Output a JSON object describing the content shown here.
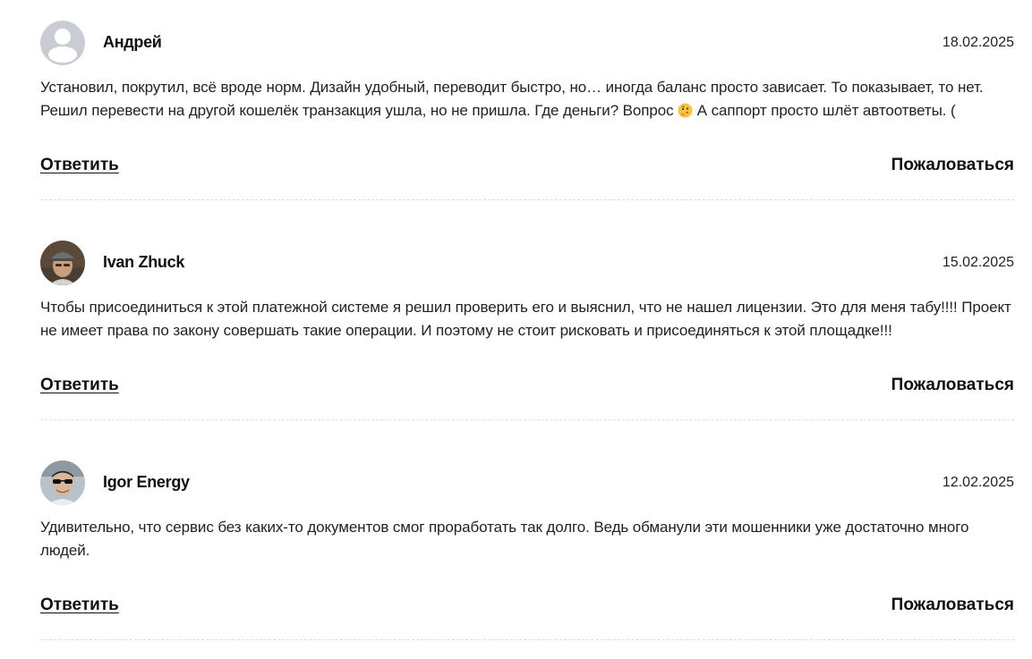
{
  "comments": [
    {
      "author": "Андрей",
      "date": "18.02.2025",
      "avatar": "default-user-icon",
      "text_before_emoji": "Установил, покрутил, всё вроде норм. Дизайн удобный, переводит быстро, но… иногда баланс просто зависает. То показывает, то нет. Решил перевести на другой кошелёк транзакция ушла, но не пришла. Где деньги? Вопрос ",
      "emoji": "thinking-face-emoji",
      "text_after_emoji": " А саппорт просто шлёт автоответы. (",
      "reply_label": "Ответить",
      "report_label": "Пожаловаться"
    },
    {
      "author": "Ivan Zhuck",
      "date": "15.02.2025",
      "avatar": "user-photo-cap",
      "text": "Чтобы присоединиться к этой платежной системе я решил проверить его и выяснил, что не нашел лицензии. Это для меня табу!!!! Проект не имеет права по закону совершать такие операции. И поэтому не стоит рисковать и присоединяться к этой площадке!!!",
      "reply_label": "Ответить",
      "report_label": "Пожаловаться"
    },
    {
      "author": "Igor Energy",
      "date": "12.02.2025",
      "avatar": "user-photo-sunglasses",
      "text": "Удивительно, что сервис без каких-то документов смог проработать так долго. Ведь обманули эти мошенники уже достаточно много людей.",
      "reply_label": "Ответить",
      "report_label": "Пожаловаться"
    }
  ],
  "colors": {
    "text": "#222222",
    "divider": "#dcdcdc",
    "avatar_default_bg": "#c9ccd3"
  }
}
